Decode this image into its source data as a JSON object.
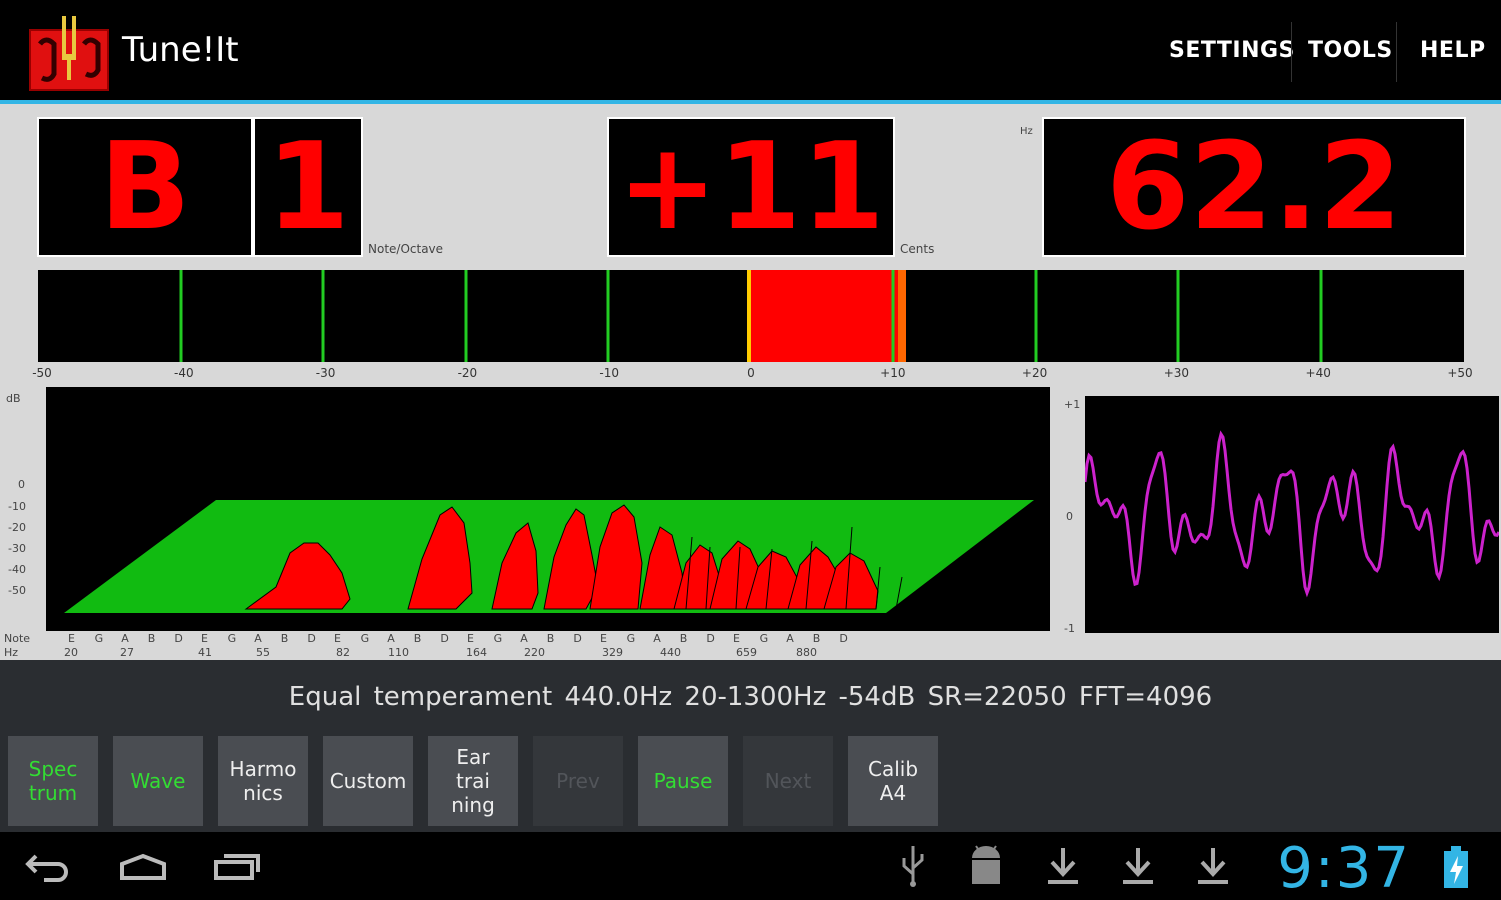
{
  "app": {
    "title": "Tune!It"
  },
  "menu": {
    "settings": "SETTINGS",
    "tools": "TOOLS",
    "help": "HELP"
  },
  "display": {
    "note": "B",
    "octave": "1",
    "note_octave_label": "Note/Octave",
    "cents": "+11",
    "cents_label": "Cents",
    "freq_unit": "Hz",
    "frequency": "62.2"
  },
  "meter": {
    "tick_labels": [
      "-50",
      "-40",
      "-30",
      "-20",
      "-10",
      "0",
      "+10",
      "+20",
      "+30",
      "+40",
      "+50"
    ],
    "cents_value": 11
  },
  "spectrum": {
    "y_unit": "dB",
    "y_labels": [
      "0",
      "-10",
      "-20",
      "-30",
      "-40",
      "-50"
    ],
    "note_row_label": "Note",
    "hz_row_label": "Hz",
    "note_labels": [
      "E",
      "G",
      "A",
      "B",
      "D",
      "E",
      "G",
      "A",
      "B",
      "D",
      "E",
      "G",
      "A",
      "B",
      "D",
      "E",
      "G",
      "A",
      "B",
      "D",
      "E",
      "G",
      "A",
      "B",
      "D",
      "E",
      "G",
      "A",
      "B",
      "D"
    ],
    "hz_labels": [
      "20",
      "27",
      "41",
      "55",
      "82",
      "110",
      "164",
      "220",
      "329",
      "440",
      "659",
      "880"
    ]
  },
  "wave": {
    "y_labels": [
      "+1",
      "0",
      "-1"
    ]
  },
  "status": {
    "text": "Equal temperament  440.0Hz  20-1300Hz  -54dB  SR=22050 FFT=4096"
  },
  "buttons": [
    {
      "label": "Spec\ntrum",
      "state": "active"
    },
    {
      "label": "Wave",
      "state": "active"
    },
    {
      "label": "Harmo\nnics",
      "state": "normal"
    },
    {
      "label": "Custom",
      "state": "normal"
    },
    {
      "label": "Ear\ntrai\nning",
      "state": "normal"
    },
    {
      "label": "Prev",
      "state": "disabled"
    },
    {
      "label": "Pause",
      "state": "active"
    },
    {
      "label": "Next",
      "state": "disabled"
    },
    {
      "label": "Calib\nA4",
      "state": "normal"
    }
  ],
  "system": {
    "clock": "9:37"
  },
  "colors": {
    "accent": "#33b5e5",
    "display_red": "#ff0000",
    "tick_green": "#22cc22",
    "active_green": "#33dd33",
    "wave_magenta": "#cc22cc"
  }
}
